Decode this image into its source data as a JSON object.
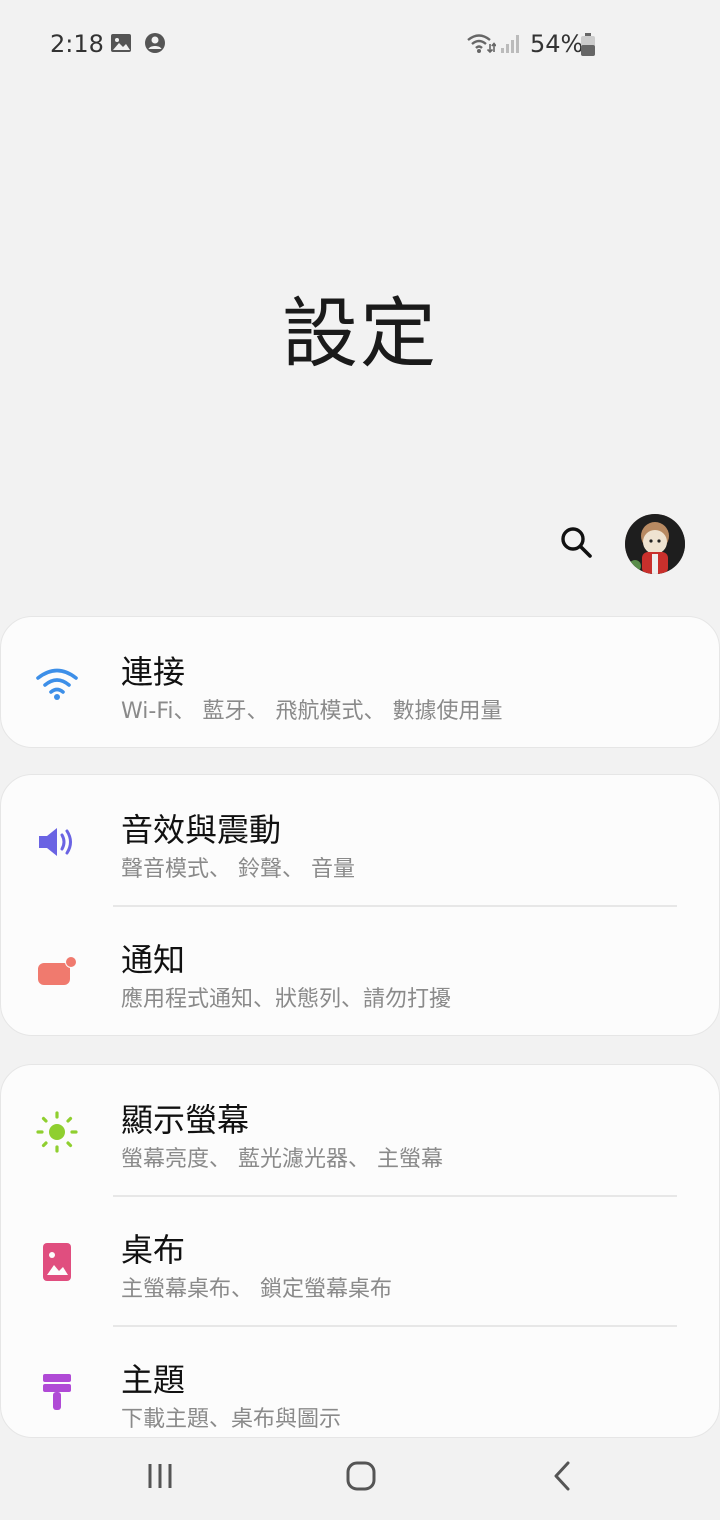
{
  "status_bar": {
    "time": "2:18",
    "battery_percent": "54%"
  },
  "title": "設定",
  "cards": [
    {
      "items": [
        {
          "title": "連接",
          "subtitle": "Wi-Fi、 藍牙、 飛航模式、 數據使用量",
          "icon": "wifi-icon",
          "icon_color": "#3d8fe8"
        }
      ]
    },
    {
      "items": [
        {
          "title": "音效與震動",
          "subtitle": "聲音模式、 鈴聲、 音量",
          "icon": "sound-icon",
          "icon_color": "#6a63e3"
        },
        {
          "title": "通知",
          "subtitle": "應用程式通知、狀態列、請勿打擾",
          "icon": "notification-icon",
          "icon_color": "#f07a6e"
        }
      ]
    },
    {
      "items": [
        {
          "title": "顯示螢幕",
          "subtitle": "螢幕亮度、 藍光濾光器、 主螢幕",
          "icon": "brightness-icon",
          "icon_color": "#8fcf2f"
        },
        {
          "title": "桌布",
          "subtitle": "主螢幕桌布、 鎖定螢幕桌布",
          "icon": "wallpaper-icon",
          "icon_color": "#e04e7f"
        },
        {
          "title": "主題",
          "subtitle": "下載主題、桌布與圖示",
          "icon": "theme-icon",
          "icon_color": "#b04ad6"
        }
      ]
    }
  ],
  "nav": {
    "recents_icon": "recents-icon",
    "home_icon": "home-icon",
    "back_icon": "back-icon"
  }
}
